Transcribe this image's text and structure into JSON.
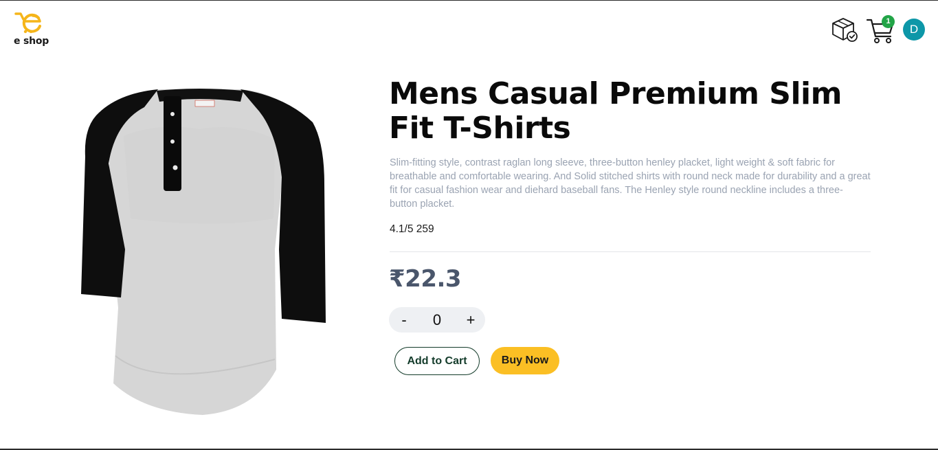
{
  "header": {
    "logo_text": "e shop",
    "cart_count": "1",
    "avatar_initial": "D",
    "icons": [
      "logo-icon",
      "orders-box-icon",
      "cart-icon"
    ]
  },
  "product": {
    "title": "Mens Casual Premium Slim Fit T-Shirts",
    "description": "Slim-fitting style, contrast raglan long sleeve, three-button henley placket, light weight & soft fabric for breathable and comfortable wearing. And Solid stitched shirts with round neck made for durability and a great fit for casual fashion wear and diehard baseball fans. The Henley style round neckline includes a three-button placket.",
    "rating": "4.1/5",
    "rating_count": "259",
    "price": "₹22.3",
    "quantity": "0",
    "minus_label": "-",
    "plus_label": "+",
    "add_to_cart_label": "Add to Cart",
    "buy_now_label": "Buy Now"
  },
  "colors": {
    "accent_yellow": "#fbbf24",
    "badge_green": "#22a447",
    "avatar_teal": "#0d97a8",
    "price_slate": "#4a566b",
    "description_gray": "#9aa3b2"
  }
}
